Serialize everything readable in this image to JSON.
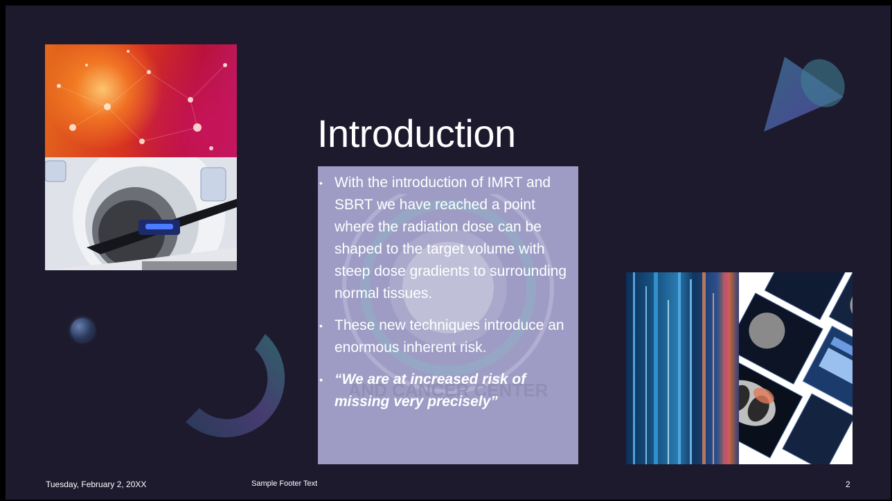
{
  "slide": {
    "title": "Introduction",
    "bullets": [
      "With the introduction of IMRT and SBRT we have reached a point where the radiation dose can be shaped to the target volume with steep dose gradients to surrounding normal tissues.",
      "These new techniques introduce an enormous inherent risk.",
      "“We are at increased risk of missing very precisely”"
    ],
    "bullet_marker": "•",
    "watermark_text": "AND CANCER CENTER",
    "footer": {
      "date": "Tuesday, February 2, 20XX",
      "text": "Sample Footer Text",
      "page_number": "2"
    }
  },
  "colors": {
    "background": "#1d1a2e",
    "content_box": "#9e9cc4",
    "text": "#ffffff"
  },
  "images": {
    "top_left": "abstract-network-photo",
    "mid_left": "linear-accelerator-photo",
    "bottom_right_a": "data-visualization-photo",
    "bottom_right_b": "ct-scan-screens-photo"
  }
}
